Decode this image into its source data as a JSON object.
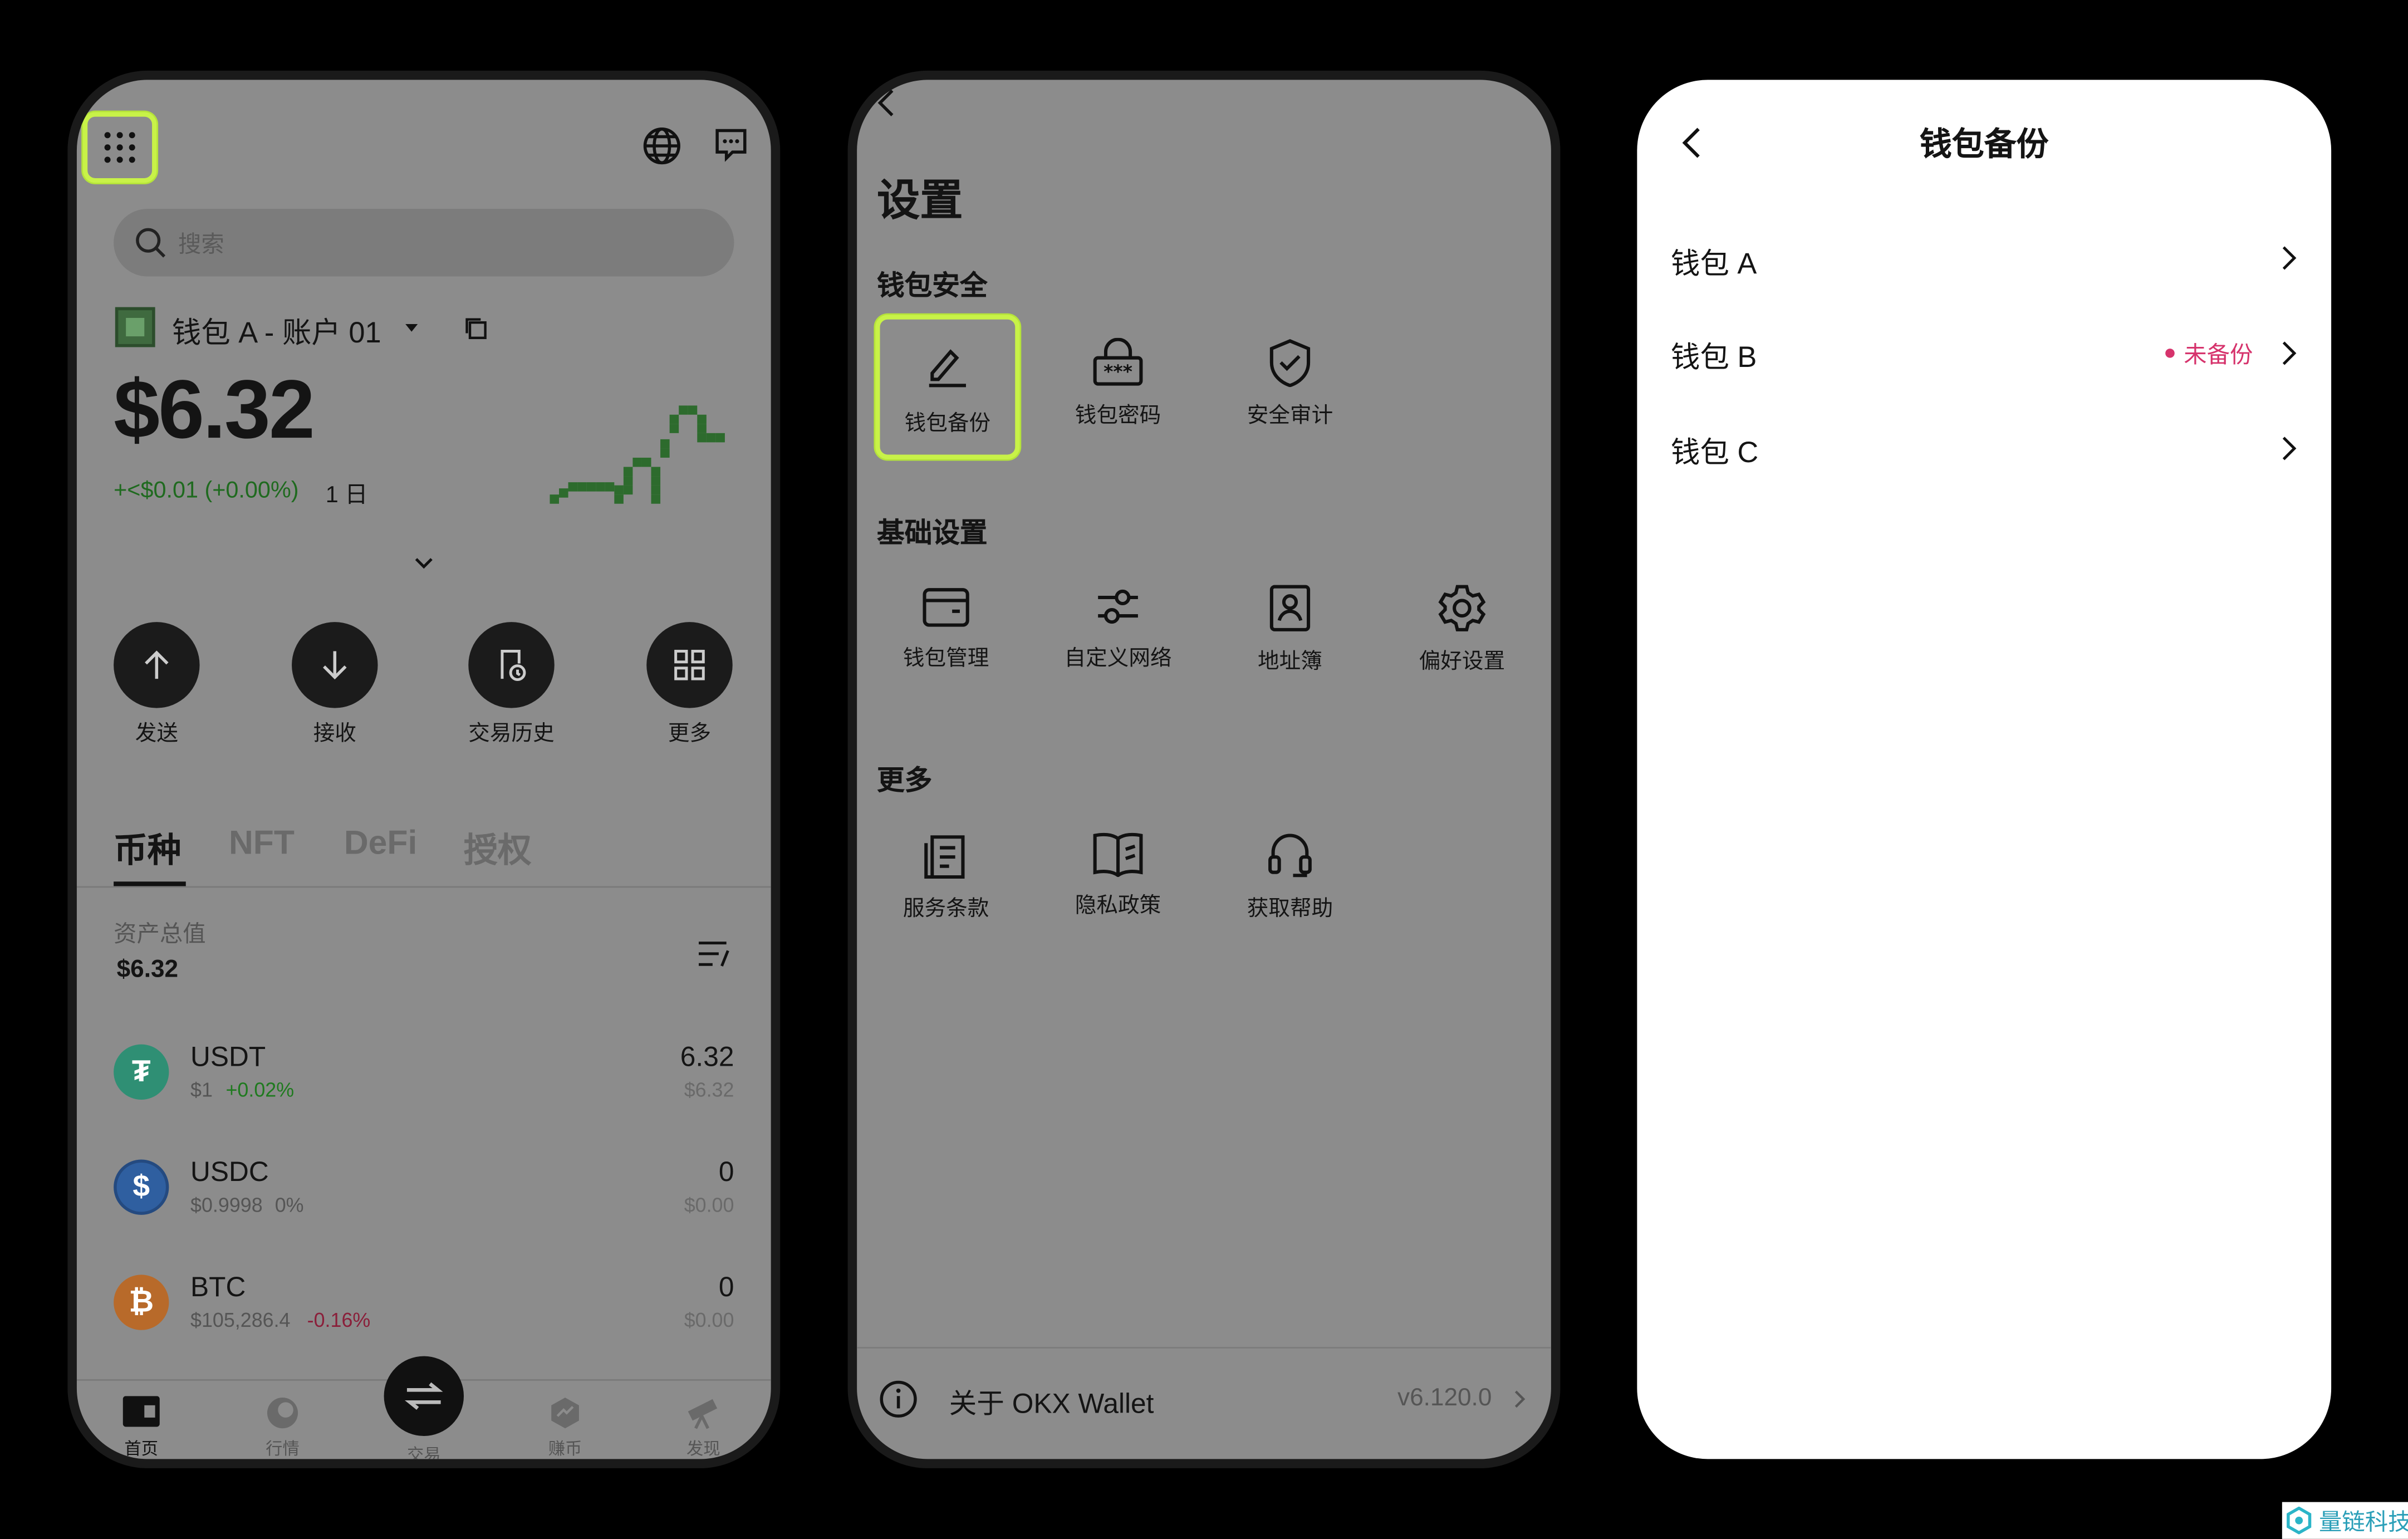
{
  "home": {
    "search_placeholder": "搜索",
    "account_name": "钱包 A - 账户 01",
    "balance": "$6.32",
    "change": "+<$0.01 (+0.00%)",
    "period": "1 日",
    "actions": [
      {
        "label": "发送",
        "icon": "arrow-up-icon"
      },
      {
        "label": "接收",
        "icon": "arrow-down-icon"
      },
      {
        "label": "交易历史",
        "icon": "history-icon"
      },
      {
        "label": "更多",
        "icon": "grid-icon"
      }
    ],
    "tabs": [
      "币种",
      "NFT",
      "DeFi",
      "授权"
    ],
    "total_label": "资产总值",
    "total_value": "$6.32",
    "assets": [
      {
        "symbol": "USDT",
        "price": "$1",
        "change": "+0.02%",
        "amount": "6.32",
        "value": "$6.32",
        "change_color": "#1f7a1f",
        "coin_color": "#2f8f74",
        "glyph": "₮"
      },
      {
        "symbol": "USDC",
        "price": "$0.9998",
        "change": "0%",
        "amount": "0",
        "value": "$0.00",
        "change_color": "#555555",
        "coin_color": "#2f5fa0",
        "glyph": "$"
      },
      {
        "symbol": "BTC",
        "price": "$105,286.4",
        "change": "-0.16%",
        "amount": "0",
        "value": "$0.00",
        "change_color": "#8a1f3a",
        "coin_color": "#b86a2a",
        "glyph": "₿"
      }
    ],
    "bottom_nav": [
      {
        "label": "首页",
        "icon": "wallet-icon"
      },
      {
        "label": "行情",
        "icon": "chart-icon"
      },
      {
        "label": "交易",
        "icon": "swap-icon"
      },
      {
        "label": "赚币",
        "icon": "earn-icon"
      },
      {
        "label": "发现",
        "icon": "telescope-icon"
      }
    ]
  },
  "settings": {
    "title": "设置",
    "sections": [
      {
        "title": "钱包安全",
        "items": [
          {
            "label": "钱包备份",
            "icon": "pencil-icon"
          },
          {
            "label": "钱包密码",
            "icon": "password-icon"
          },
          {
            "label": "安全审计",
            "icon": "shield-check-icon"
          }
        ]
      },
      {
        "title": "基础设置",
        "items": [
          {
            "label": "钱包管理",
            "icon": "wallet-icon"
          },
          {
            "label": "自定义网络",
            "icon": "sliders-icon"
          },
          {
            "label": "地址簿",
            "icon": "contacts-icon"
          },
          {
            "label": "偏好设置",
            "icon": "gear-icon"
          }
        ]
      },
      {
        "title": "更多",
        "items": [
          {
            "label": "服务条款",
            "icon": "document-icon"
          },
          {
            "label": "隐私政策",
            "icon": "book-icon"
          },
          {
            "label": "获取帮助",
            "icon": "headset-icon"
          }
        ]
      }
    ],
    "about_label": "关于 OKX Wallet",
    "version": "v6.120.0"
  },
  "backup": {
    "title": "钱包备份",
    "wallets": [
      {
        "name": "钱包 A",
        "badge": ""
      },
      {
        "name": "钱包 B",
        "badge": "未备份"
      },
      {
        "name": "钱包 C",
        "badge": ""
      }
    ],
    "badge_color": "#d6336c"
  },
  "watermark": "量链科技"
}
